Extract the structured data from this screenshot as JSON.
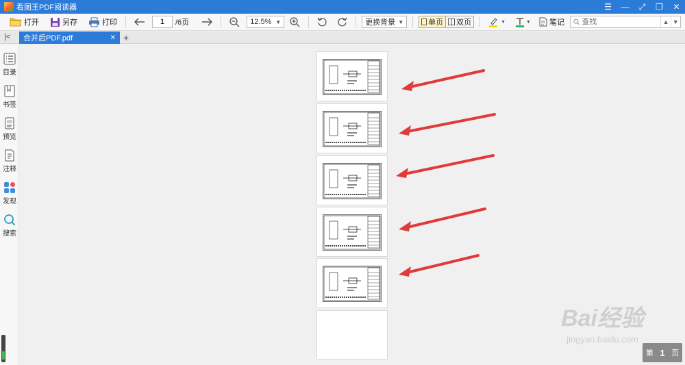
{
  "titlebar": {
    "title": "看图王PDF阅读器"
  },
  "toolbar": {
    "open_label": "打开",
    "saveas_label": "另存",
    "print_label": "打印",
    "current_page": "1",
    "total_pages": "/6页",
    "zoom": "12.5%",
    "background_label": "更换背景",
    "single_page_label": "单页",
    "double_page_label": "双页",
    "note_label": "笔记",
    "search_placeholder": "查找"
  },
  "tabs": {
    "doc_tab_label": "合并后PDF.pdf"
  },
  "sidebar": {
    "items": [
      {
        "label": "目录"
      },
      {
        "label": "书签"
      },
      {
        "label": "预览"
      },
      {
        "label": "注释"
      },
      {
        "label": "发现"
      },
      {
        "label": "搜索"
      }
    ]
  },
  "watermark": {
    "brand": "Bai经验",
    "url": "jingyan.baidu.com"
  },
  "page_indicator": {
    "prefix": "第",
    "number": "1",
    "suffix": "页"
  },
  "colors": {
    "accent": "#2b7bd9",
    "arrow": "#e03a3a",
    "single_page_active": "#fff4c4"
  }
}
